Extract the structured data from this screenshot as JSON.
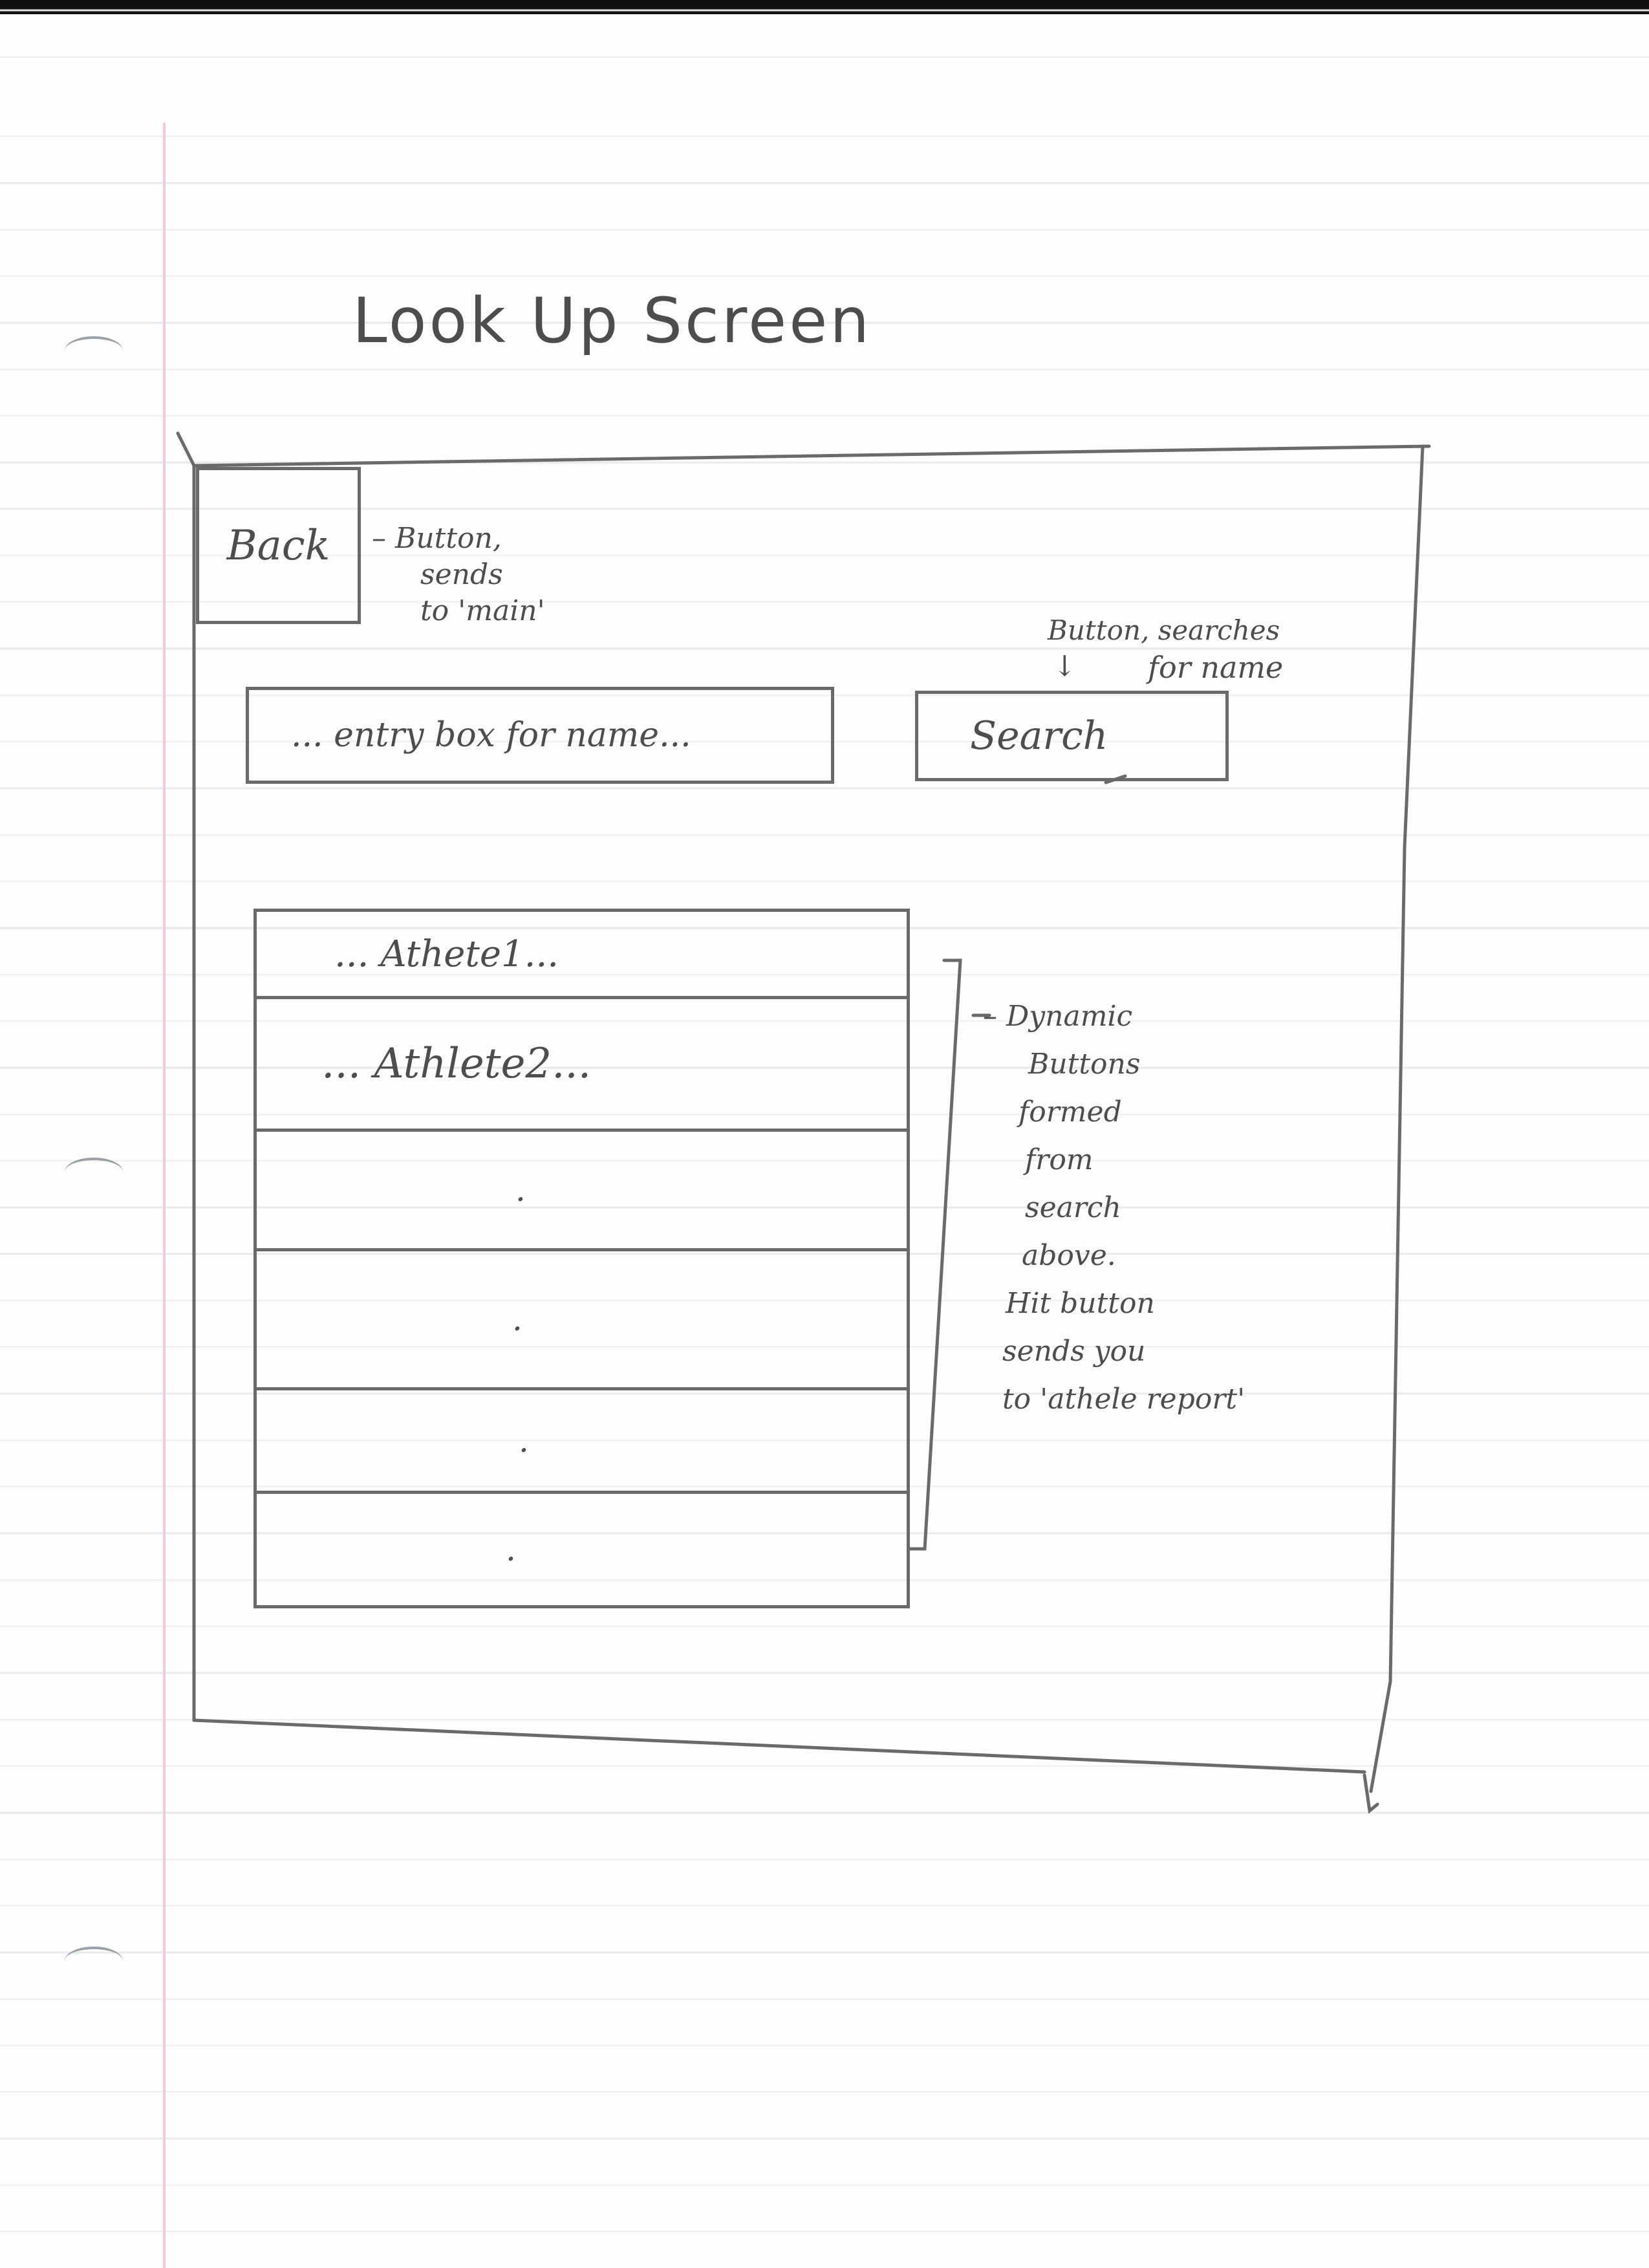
{
  "title": "Look Up Screen",
  "back_button": {
    "label": "Back"
  },
  "back_note": {
    "lines": [
      "– Button,",
      "sends",
      "to 'main'"
    ]
  },
  "entry_box": {
    "placeholder": "... entry box for name..."
  },
  "search_note": {
    "lines": [
      "Button, searches",
      "↓",
      "for name"
    ]
  },
  "search_button": {
    "label": "Search"
  },
  "results": {
    "rows": [
      "... Athete1...",
      "... Athlete2...",
      ".",
      ".",
      ".",
      "."
    ]
  },
  "results_note": {
    "lines": [
      "– Dynamic",
      "Buttons",
      "formed",
      "from",
      "search",
      "above.",
      "Hit button",
      "sends you",
      "to 'athele report'"
    ]
  }
}
